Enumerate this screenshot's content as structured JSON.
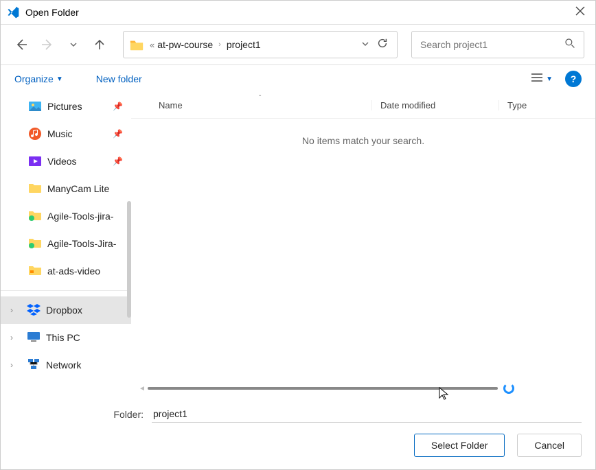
{
  "window": {
    "title": "Open Folder"
  },
  "nav": {
    "breadcrumb": {
      "seg1": "at-pw-course",
      "seg2": "project1"
    },
    "search_placeholder": "Search project1"
  },
  "toolbar": {
    "organize": "Organize",
    "new_folder": "New folder"
  },
  "sidebar": {
    "items": [
      {
        "label": "Pictures",
        "icon": "pictures",
        "pinned": true
      },
      {
        "label": "Music",
        "icon": "music",
        "pinned": true
      },
      {
        "label": "Videos",
        "icon": "videos",
        "pinned": true
      },
      {
        "label": "ManyCam Lite",
        "icon": "folder",
        "pinned": false
      },
      {
        "label": "Agile-Tools-jira-",
        "icon": "folder-g",
        "pinned": false
      },
      {
        "label": "Agile-Tools-Jira-",
        "icon": "folder-g",
        "pinned": false
      },
      {
        "label": "at-ads-video",
        "icon": "folder-o",
        "pinned": false
      }
    ],
    "roots": [
      {
        "label": "Dropbox",
        "icon": "dropbox",
        "selected": true
      },
      {
        "label": "This PC",
        "icon": "pc",
        "selected": false
      },
      {
        "label": "Network",
        "icon": "network",
        "selected": false
      }
    ]
  },
  "columns": {
    "name": "Name",
    "date": "Date modified",
    "type": "Type"
  },
  "content": {
    "empty_message": "No items match your search."
  },
  "footer": {
    "folder_label": "Folder:",
    "folder_value": "project1",
    "select": "Select Folder",
    "cancel": "Cancel"
  }
}
